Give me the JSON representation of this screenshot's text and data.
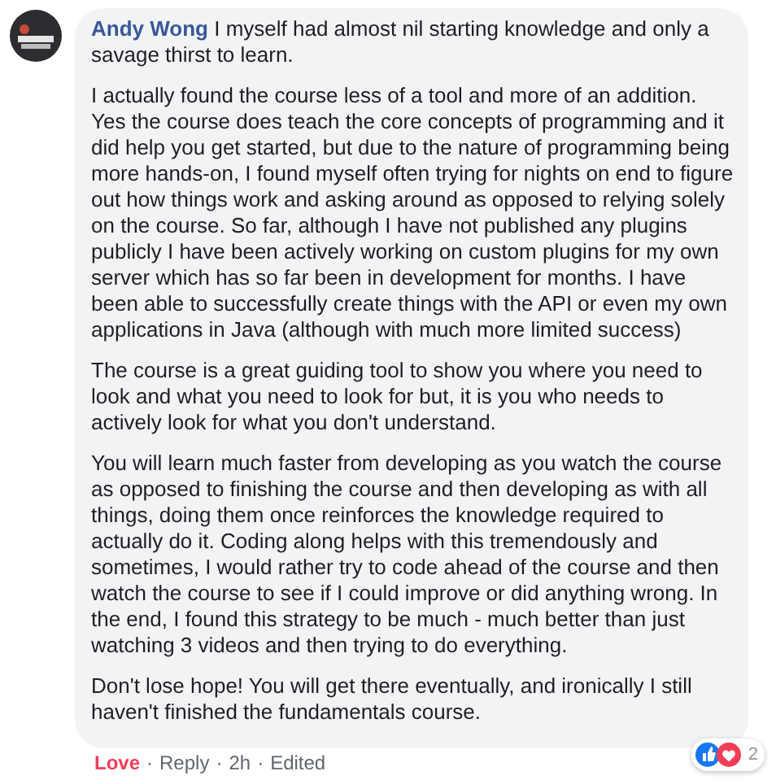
{
  "comment": {
    "author": "Andy Wong",
    "paragraphs": [
      "I myself had almost nil starting knowledge and only a savage thirst to learn.",
      "I actually found the course less of a tool and more of an addition.\nYes the course does teach the core concepts of programming and it did help you get started, but due to the nature of programming being more hands-on, I found myself often trying for nights on end to figure out how things work and asking around as opposed to relying solely on the course. So far, although I have not published any plugins publicly I have been actively working on custom plugins for my own server which has so far been in development for months. I have been able to successfully create things with the API or even my own applications in Java (although with much more limited success)",
      "The course is a great guiding tool to show you where you need to look and what you need to look for but, it is you who needs to actively look for what you don't understand.",
      "You will learn much faster from developing as you watch the course as opposed to finishing the course and then developing as with all things, doing them once reinforces the knowledge required to actually do it. Coding along helps with this tremendously and sometimes, I would rather try to code ahead of the course and then watch the course to see if I could improve or did anything wrong. In the end, I found this strategy to be much - much better than just watching 3 videos and then trying to do everything.",
      "Don't lose hope! You will get there eventually, and ironically I still haven't finished the fundamentals course."
    ],
    "reaction_count": "2"
  },
  "separator": "·",
  "actions": [
    {
      "kind": "reaction",
      "label": "Love",
      "selected": true
    },
    {
      "kind": "link",
      "label": "Reply"
    },
    {
      "kind": "time",
      "label": "2h"
    },
    {
      "kind": "link",
      "label": "Edited"
    }
  ]
}
